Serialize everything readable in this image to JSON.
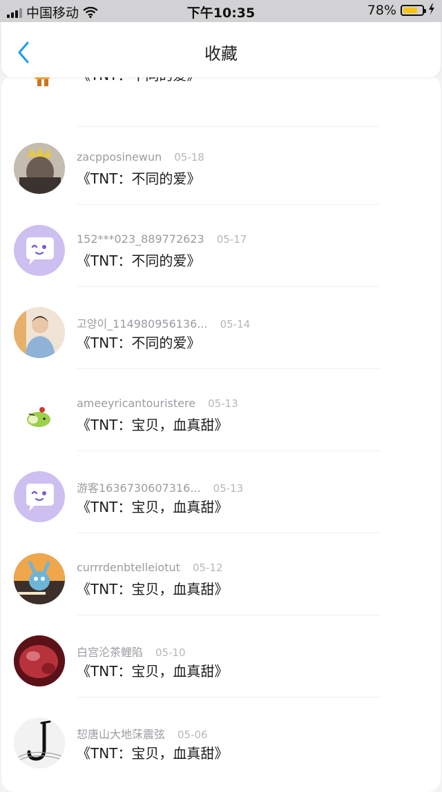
{
  "status_bar": {
    "carrier": "中国移动",
    "time": "下午10:35",
    "battery": "78%",
    "battery_level": 0.78
  },
  "nav": {
    "title": "收藏",
    "back_icon": "chevron-left-icon",
    "accent_color": "#1a9bf0"
  },
  "items": [
    {
      "username": "",
      "date": "",
      "title": "《TNT：不同的爱》",
      "avatar": "robot-figure"
    },
    {
      "username": "zacpposinewun",
      "date": "05-18",
      "title": "《TNT：不同的爱》",
      "avatar": "photo-crown"
    },
    {
      "username": "152***023_889772623",
      "date": "05-17",
      "title": "《TNT：不同的爱》",
      "avatar": "default-chat"
    },
    {
      "username": "고양이_114980956136...",
      "date": "05-14",
      "title": "《TNT：不同的爱》",
      "avatar": "photo-person"
    },
    {
      "username": "ameeyricantouristere",
      "date": "05-13",
      "title": "《TNT：宝贝，血真甜》",
      "avatar": "green-bird"
    },
    {
      "username": "游客1636730607316...",
      "date": "05-13",
      "title": "《TNT：宝贝，血真甜》",
      "avatar": "default-chat"
    },
    {
      "username": "currrdenbtelleiotut",
      "date": "05-12",
      "title": "《TNT：宝贝，血真甜》",
      "avatar": "cartoon-cat"
    },
    {
      "username": "白宫沦茶鲤陷",
      "date": "05-10",
      "title": "《TNT：宝贝，血真甜》",
      "avatar": "red-drink"
    },
    {
      "username": "恝唐山大地莯震弦",
      "date": "05-06",
      "title": "《TNT：宝贝，血真甜》",
      "avatar": "saxophone"
    }
  ]
}
